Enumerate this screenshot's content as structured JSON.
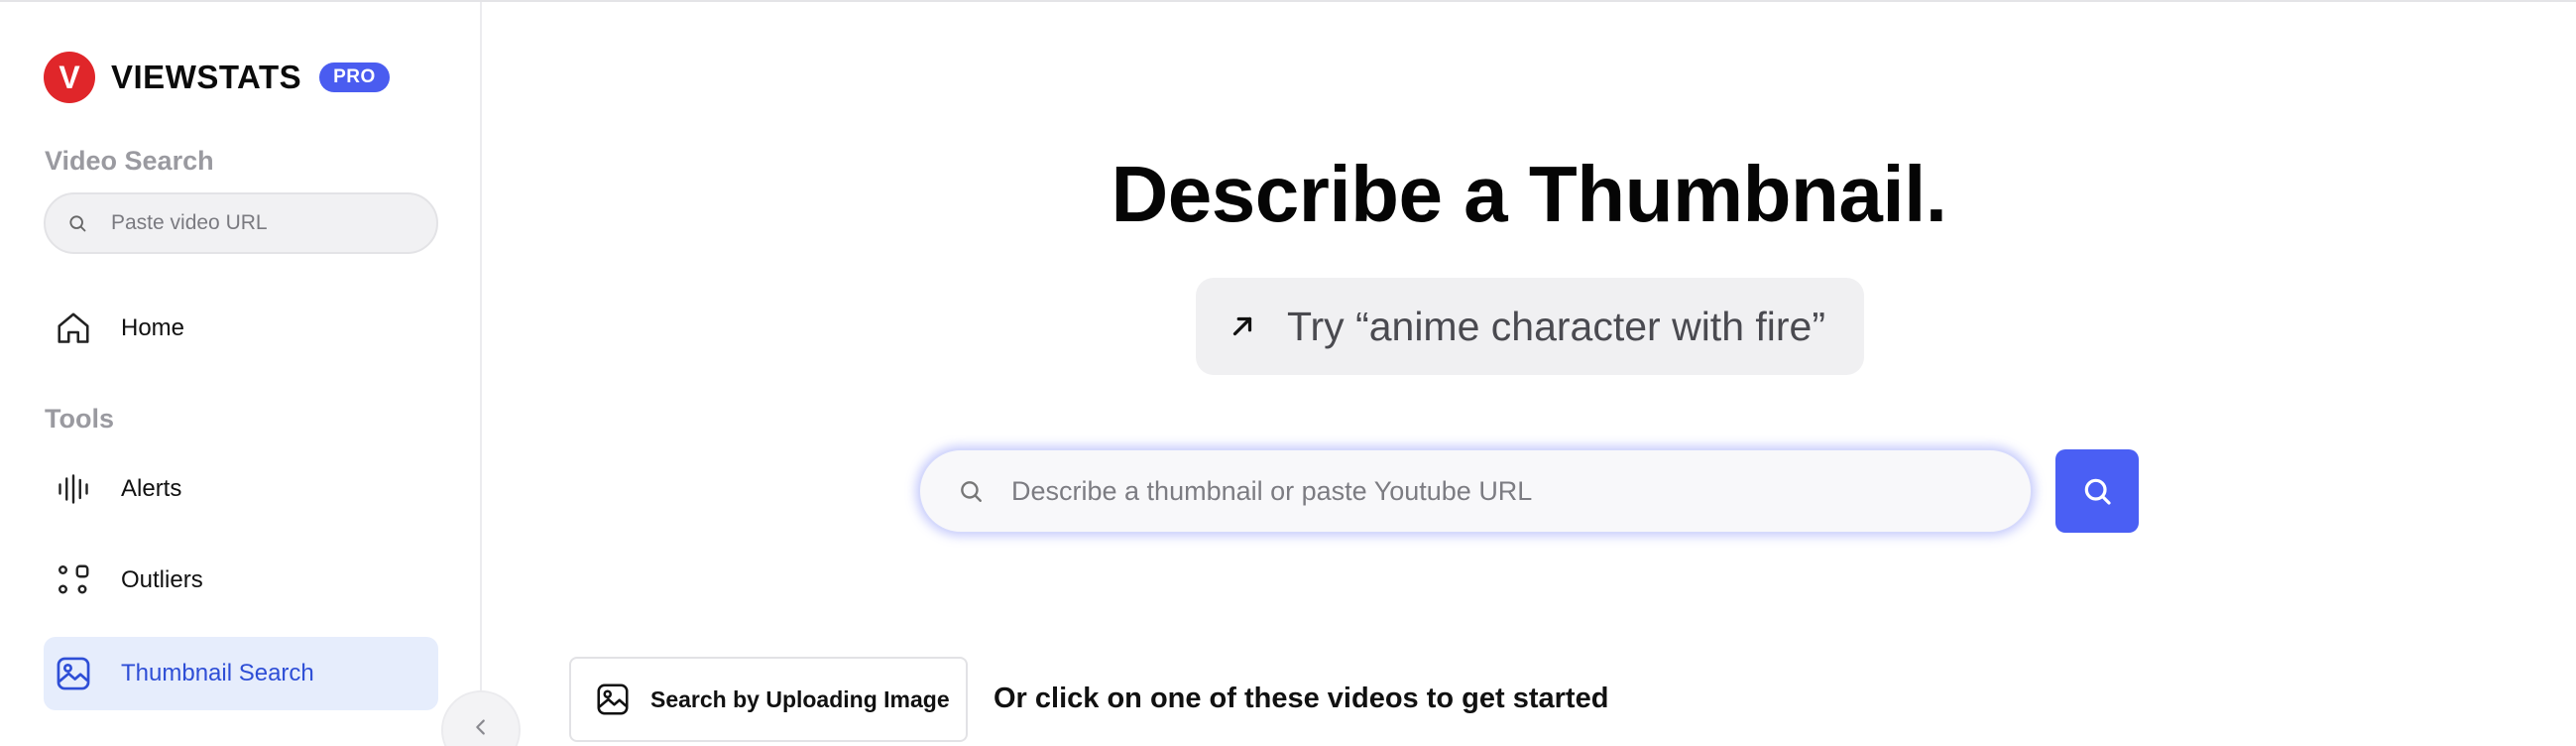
{
  "brand": {
    "logo_letter": "V",
    "name": "VIEWSTATS",
    "badge": "PRO"
  },
  "sidebar": {
    "video_search_title": "Video Search",
    "video_search_placeholder": "Paste video URL",
    "home_label": "Home",
    "tools_title": "Tools",
    "tools": [
      {
        "label": "Alerts",
        "icon": "alerts-bars-icon"
      },
      {
        "label": "Outliers",
        "icon": "outliers-icon"
      },
      {
        "label": "Thumbnail Search",
        "icon": "image-icon",
        "active": true
      }
    ],
    "collapse_icon": "chevron-left-icon"
  },
  "main": {
    "headline": "Describe a Thumbnail.",
    "suggestion": "Try “anime character with fire”",
    "search_placeholder": "Describe a thumbnail or paste Youtube URL",
    "upload_label": "Search by Uploading Image",
    "get_started_text": "Or click on one of these videos to get started"
  },
  "colors": {
    "brand_red": "#e0262a",
    "accent_blue": "#4a5ff4",
    "active_bg": "#e6edfc",
    "active_text": "#2e4ed6"
  }
}
